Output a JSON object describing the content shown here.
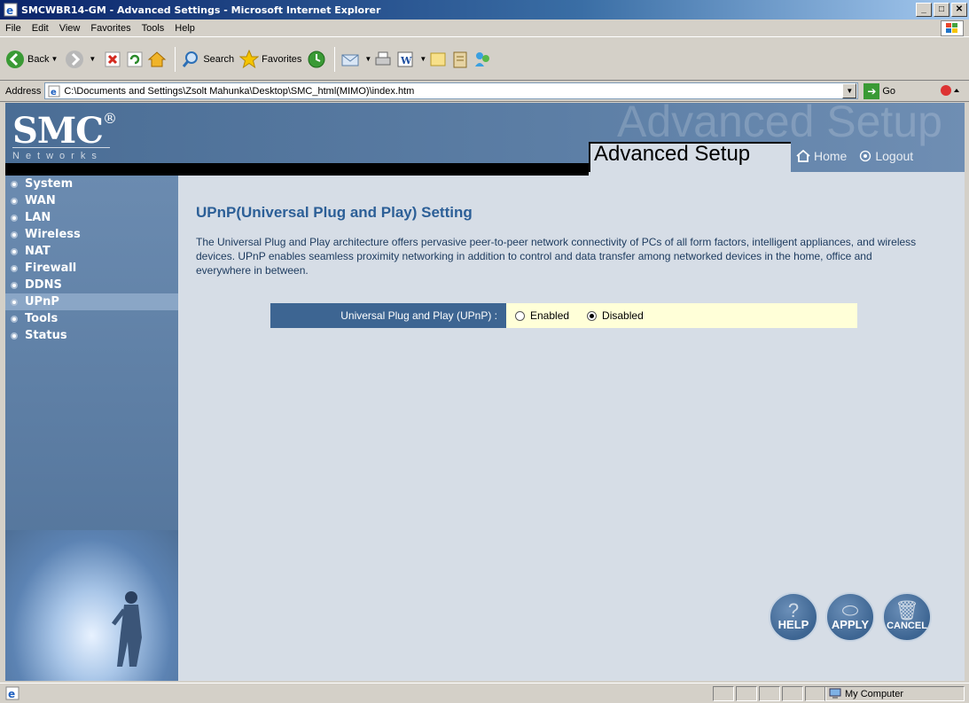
{
  "window": {
    "title": "SMCWBR14-GM - Advanced Settings - Microsoft Internet Explorer",
    "minimize": "_",
    "maximize": "□",
    "close": "✕"
  },
  "menubar": {
    "items": [
      "File",
      "Edit",
      "View",
      "Favorites",
      "Tools",
      "Help"
    ]
  },
  "toolbar": {
    "back_label": "Back",
    "search_label": "Search",
    "favorites_label": "Favorites"
  },
  "address": {
    "label": "Address",
    "value": "C:\\Documents and Settings\\Zsolt Mahunka\\Desktop\\SMC_html(MIMO)\\index.htm",
    "go_label": "Go"
  },
  "header": {
    "logo": "SMC",
    "logo_reg": "®",
    "networks": "Networks",
    "bg_text": "Advanced Setup",
    "title": "Advanced Setup",
    "home": "Home",
    "logout": "Logout"
  },
  "sidebar": {
    "items": [
      {
        "label": "System"
      },
      {
        "label": "WAN"
      },
      {
        "label": "LAN"
      },
      {
        "label": "Wireless"
      },
      {
        "label": "NAT"
      },
      {
        "label": "Firewall"
      },
      {
        "label": "DDNS"
      },
      {
        "label": "UPnP"
      },
      {
        "label": "Tools"
      },
      {
        "label": "Status"
      }
    ],
    "active": "UPnP"
  },
  "content": {
    "title": "UPnP(Universal Plug and Play) Setting",
    "description": "The Universal Plug and Play architecture offers pervasive peer-to-peer network connectivity of PCs of all form factors, intelligent appliances, and wireless devices. UPnP enables seamless proximity networking in addition to control and data transfer among networked devices in the home, office and everywhere in between.",
    "setting_label": "Universal Plug and Play (UPnP) :",
    "options": {
      "enabled": "Enabled",
      "disabled": "Disabled"
    },
    "selected": "Disabled"
  },
  "actions": {
    "help": "HELP",
    "apply": "APPLY",
    "cancel": "CANCEL"
  },
  "statusbar": {
    "zone": "My Computer"
  }
}
